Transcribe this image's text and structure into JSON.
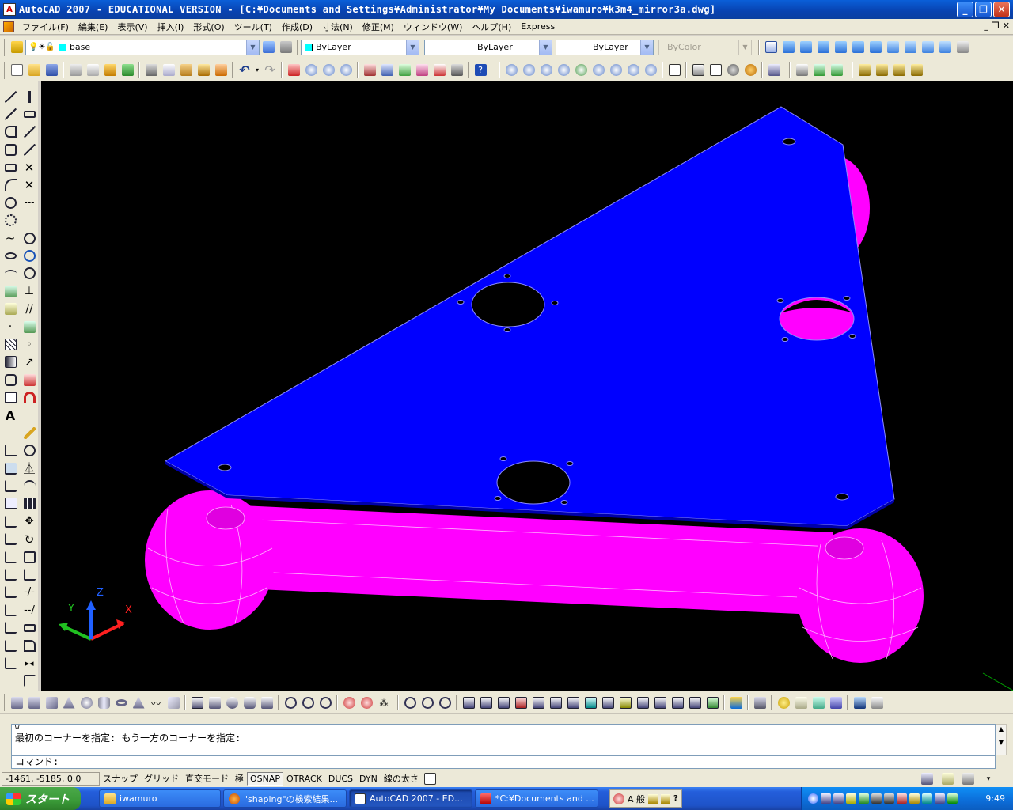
{
  "window": {
    "app_icon_label": "A",
    "title": "AutoCAD 2007 - EDUCATIONAL VERSION - [C:¥Documents and Settings¥Administrator¥My Documents¥iwamuro¥k3m4_mirror3a.dwg]",
    "minimize": "_",
    "maximize": "❐",
    "close": "✕"
  },
  "menu": {
    "items": [
      "ファイル(F)",
      "編集(E)",
      "表示(V)",
      "挿入(I)",
      "形式(O)",
      "ツール(T)",
      "作成(D)",
      "寸法(N)",
      "修正(M)",
      "ウィンドウ(W)",
      "ヘルプ(H)",
      "Express"
    ],
    "mdi_min": "_",
    "mdi_restore": "❐",
    "mdi_close": "✕"
  },
  "properties": {
    "layer": "base",
    "color": "ByLayer",
    "linetype": "ByLayer",
    "lineweight": "ByLayer",
    "plotstyle": "ByColor"
  },
  "ucs": {
    "x": "X",
    "y": "Y",
    "z": "Z"
  },
  "command": {
    "history": [
      "w",
      "最初のコーナーを指定: もう一方のコーナーを指定:"
    ],
    "prompt": "コマンド:"
  },
  "status": {
    "coords": "-1461, -5185, 0.0",
    "toggles": [
      "スナップ",
      "グリッド",
      "直交モード",
      "極",
      "OSNAP",
      "OTRACK",
      "DUCS",
      "DYN",
      "線の太さ"
    ],
    "active_toggle": "OSNAP"
  },
  "taskbar": {
    "start": "スタート",
    "tasks": [
      "iwamuro",
      "\"shaping\"の検索結果...",
      "AutoCAD 2007 - ED...",
      "*C:¥Documents and ..."
    ],
    "ime": "A 般",
    "clock": "9:49"
  },
  "colors": {
    "plate": "#0000ff",
    "frame": "#ff00ff",
    "viewport": "#000000",
    "titlebar": "#0842b0"
  }
}
